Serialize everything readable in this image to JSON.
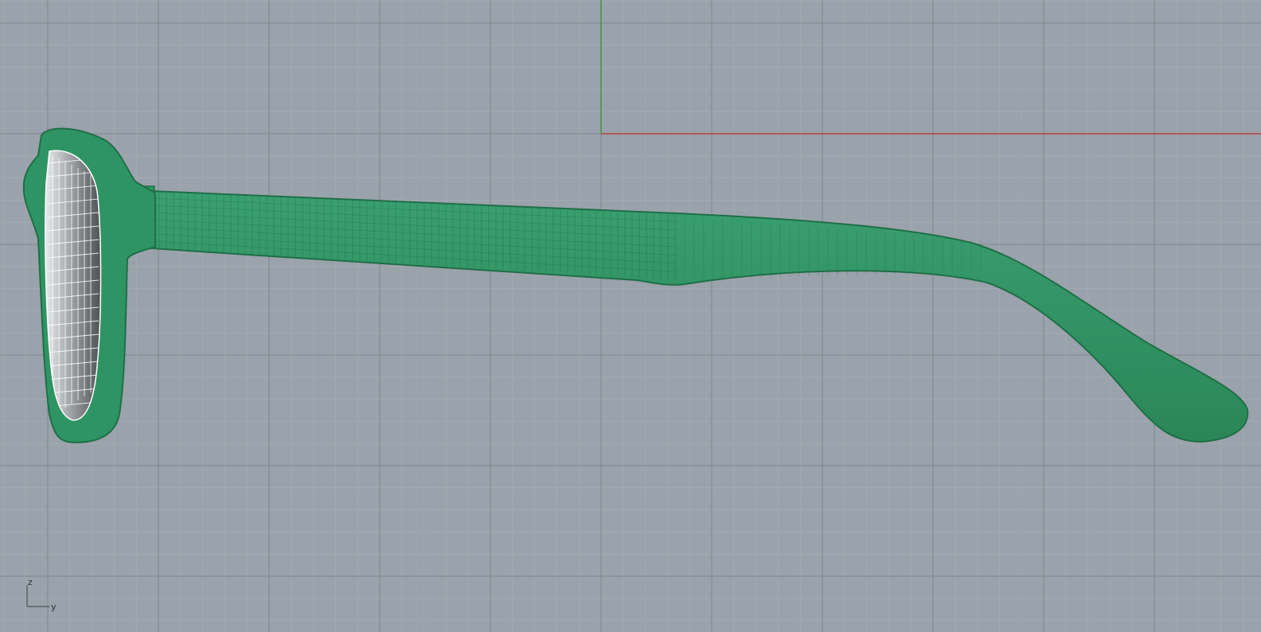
{
  "viewport": {
    "background_color": "#9aa2ab",
    "grid_minor_color": "#a7aeb6",
    "grid_major_color": "#7f868e",
    "x_axis_color": "#b3463f",
    "y_axis_color": "#3a9a3a",
    "model_color": "#2c8a5b",
    "model_wire_color": "#1f6f47",
    "lens_color": "#f4f4f4"
  },
  "axis_widget": {
    "icon": "axis-triad-icon",
    "vertical_label": "z",
    "horizontal_label": "y"
  }
}
